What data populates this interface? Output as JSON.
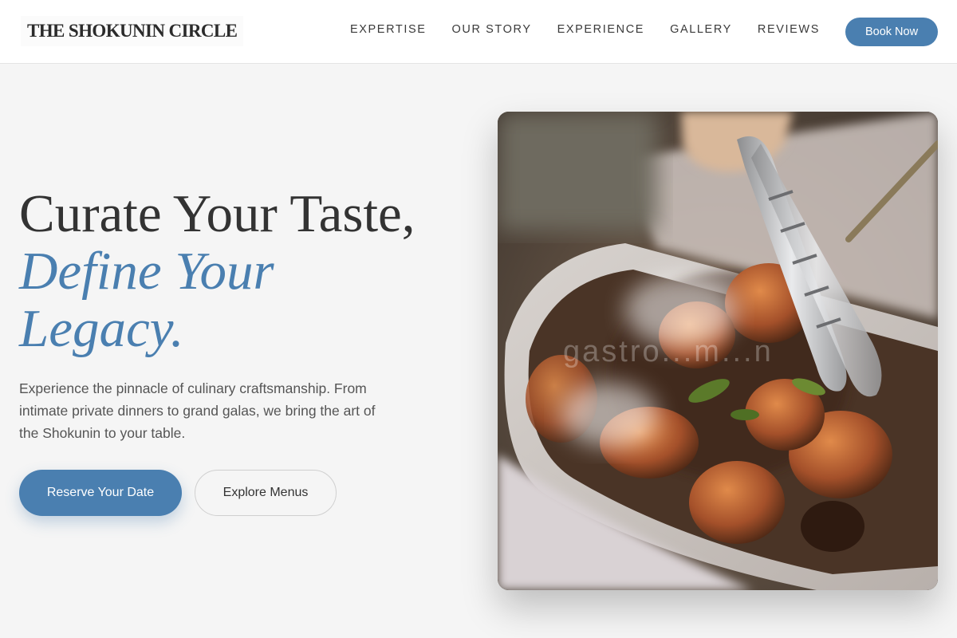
{
  "brand": {
    "name": "THE SHOKUNIN CIRCLE"
  },
  "nav": {
    "items": [
      {
        "label": "EXPERTISE"
      },
      {
        "label": "OUR STORY"
      },
      {
        "label": "EXPERIENCE"
      },
      {
        "label": "GALLERY"
      },
      {
        "label": "REVIEWS"
      }
    ],
    "cta_label": "Book Now"
  },
  "hero": {
    "title_line1": "Curate Your Taste,",
    "title_accent_line1": "Define Your",
    "title_accent_line2": "Legacy.",
    "description": "Experience the pinnacle of culinary craftsmanship. From intimate private dinners to grand galas, we bring the art of the Shokunin to your table.",
    "primary_button": "Reserve Your Date",
    "secondary_button": "Explore Menus",
    "image": {
      "watermark": "gastro...m...n"
    }
  },
  "colors": {
    "accent": "#4a7fb0",
    "background": "#f5f5f5",
    "header_background": "#ffffff",
    "text": "#333333"
  }
}
